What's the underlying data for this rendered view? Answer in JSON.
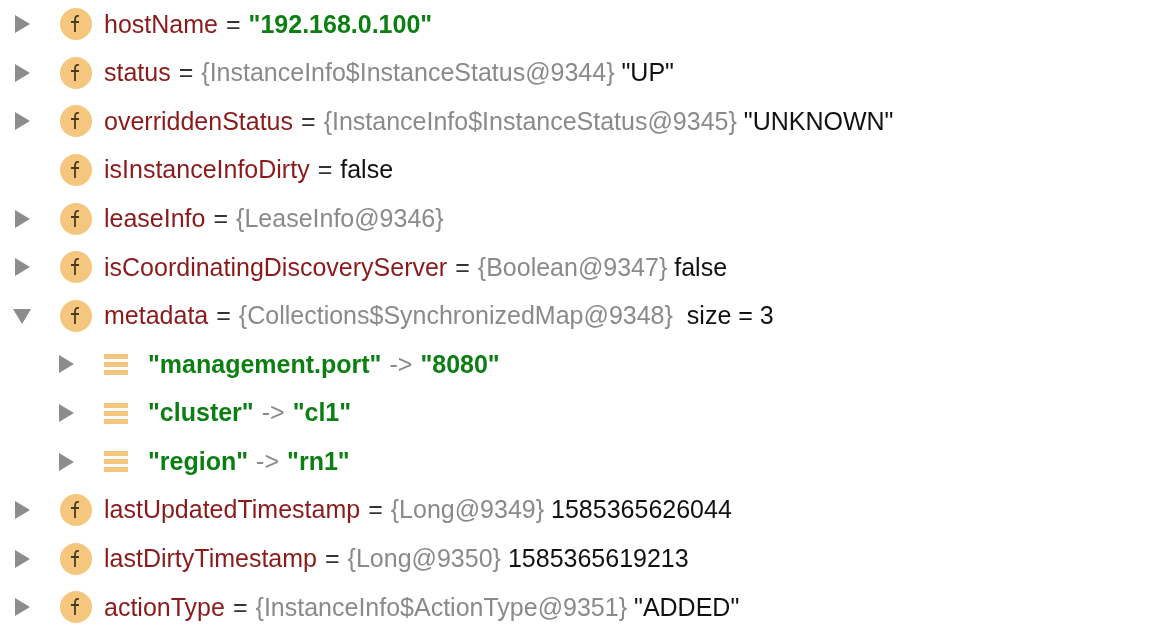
{
  "variables": [
    {
      "kind": "field",
      "expanded": false,
      "name": "hostName",
      "equals": "=",
      "value": "\"192.168.0.100\"",
      "highlighted": true
    },
    {
      "kind": "field",
      "expanded": false,
      "name": "status",
      "equals": "=",
      "type": "{InstanceInfo$InstanceStatus@9344}",
      "value": "\"UP\"",
      "highlighted": false
    },
    {
      "kind": "field",
      "expanded": false,
      "name": "overriddenStatus",
      "equals": "=",
      "type": "{InstanceInfo$InstanceStatus@9345}",
      "value": "\"UNKNOWN\"",
      "highlighted": false
    },
    {
      "kind": "field",
      "name": "isInstanceInfoDirty",
      "equals": "=",
      "value": "false",
      "highlighted": false
    },
    {
      "kind": "field",
      "expanded": false,
      "name": "leaseInfo",
      "equals": "=",
      "type": "{LeaseInfo@9346}"
    },
    {
      "kind": "field",
      "expanded": false,
      "name": "isCoordinatingDiscoveryServer",
      "equals": "=",
      "type": "{Boolean@9347}",
      "value": "false",
      "highlighted": false
    },
    {
      "kind": "field",
      "expanded": true,
      "name": "metadata",
      "equals": "=",
      "type": "{Collections$SynchronizedMap@9348}",
      "size": "size = 3",
      "children": [
        {
          "kind": "entry",
          "expanded": false,
          "key": "\"management.port\"",
          "arrow": "->",
          "value": "\"8080\"",
          "highlighted": true
        },
        {
          "kind": "entry",
          "expanded": false,
          "key": "\"cluster\"",
          "arrow": "->",
          "value": "\"cl1\"",
          "highlighted": true
        },
        {
          "kind": "entry",
          "expanded": false,
          "key": "\"region\"",
          "arrow": "->",
          "value": "\"rn1\"",
          "highlighted": true
        }
      ]
    },
    {
      "kind": "field",
      "expanded": false,
      "name": "lastUpdatedTimestamp",
      "equals": "=",
      "type": "{Long@9349}",
      "value": "1585365626044",
      "highlighted": false
    },
    {
      "kind": "field",
      "expanded": false,
      "name": "lastDirtyTimestamp",
      "equals": "=",
      "type": "{Long@9350}",
      "value": "1585365619213",
      "highlighted": false
    },
    {
      "kind": "field",
      "expanded": false,
      "name": "actionType",
      "equals": "=",
      "type": "{InstanceInfo$ActionType@9351}",
      "value": "\"ADDED\"",
      "highlighted": false
    }
  ]
}
